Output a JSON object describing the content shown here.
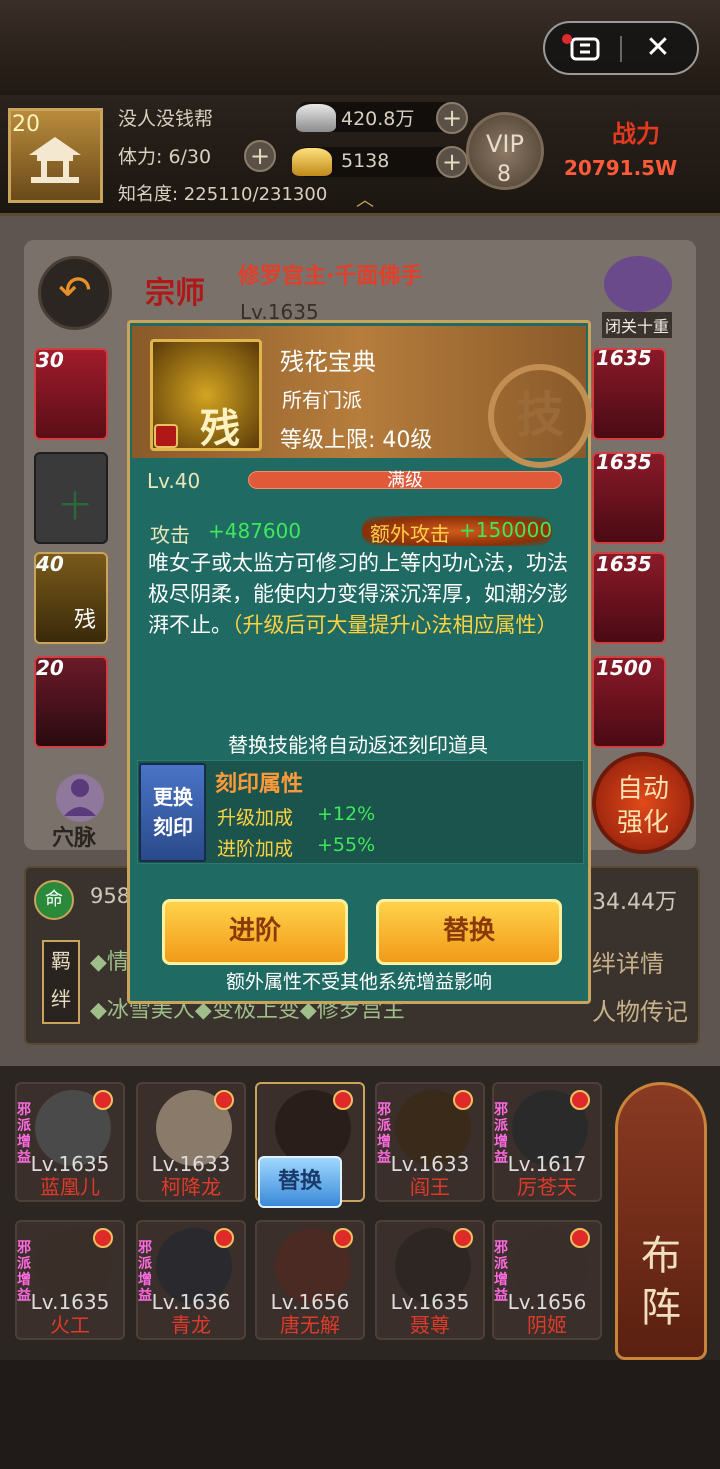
{
  "window": {
    "menu_icon": "menu-icon",
    "close_icon": "close-icon",
    "close_glyph": "✕"
  },
  "player": {
    "level": "20",
    "guild": "没人没钱帮",
    "stamina": "体力: 6/30",
    "fame": "知名度: 225110/231300",
    "silver": "420.8万",
    "gold": "5138",
    "vip_label": "VIP",
    "vip_level": "8",
    "power_label": "战力",
    "power_value": "20791.5W"
  },
  "background": {
    "hero_title": "修罗宫主·千面佛手",
    "hero_level": "Lv.1635",
    "seal": "宗师",
    "retreat_label": "闭关十重",
    "left_slots": [
      "30",
      "",
      "40",
      "20"
    ],
    "left_slot_chars": [
      "",
      "十",
      "残",
      ""
    ],
    "right_slots": [
      "1635",
      "1635",
      "1635",
      "1500"
    ],
    "acupoint_label": "穴脉",
    "auto_enhance": "自动强化",
    "life_icon": "命",
    "life_value": "958",
    "power_value": "34.44万",
    "bond_label": "羁绊",
    "bond_detail": "绊详情",
    "biography": "人物传记",
    "bond_row1": "◆情",
    "bond_row2": "◆冰雪美人◆变极上变◆修罗宫主"
  },
  "modal": {
    "skill_name": "残花宝典",
    "sect": "所有门派",
    "level_cap": "等级上限: 40级",
    "icon_char": "残",
    "emblem_char": "技",
    "level": "Lv.40",
    "level_status": "满级",
    "level_progress": 1.0,
    "attack_label": "攻击",
    "attack_value": "+487600",
    "extra_attack_label": "额外攻击",
    "extra_attack_value": "+150000",
    "description": "唯女子或太监方可修习的上等内功心法，功法极尽阴柔，能使内力变得深沉浑厚，如潮汐澎湃不止。",
    "description_hint": "（升级后可大量提升心法相应属性）",
    "notice": "替换技能将自动返还刻印道具",
    "engrave_icon": "更换刻印",
    "engrave_title": "刻印属性",
    "upgrade_bonus_label": "升级加成",
    "upgrade_bonus_value": "+12%",
    "advance_bonus_label": "进阶加成",
    "advance_bonus_value": "+55%",
    "advance_button": "进阶",
    "replace_button": "替换",
    "footer": "额外属性不受其他系统增益影响"
  },
  "heroes": {
    "row1": [
      {
        "tag": "邪派增益",
        "lv": "Lv.1635",
        "name": "蓝凰儿",
        "color": "#4a4a4a"
      },
      {
        "tag": "",
        "lv": "Lv.1633",
        "name": "柯降龙",
        "color": "#8a7a6a"
      },
      {
        "tag": "",
        "lv": "",
        "name": "",
        "color": "#2a1e1a"
      },
      {
        "tag": "邪派增益",
        "lv": "Lv.1633",
        "name": "阎王",
        "color": "#3a2a1a"
      },
      {
        "tag": "邪派增益",
        "lv": "Lv.1617",
        "name": "厉苍天",
        "color": "#2a2a2a"
      }
    ],
    "row2": [
      {
        "tag": "邪派增益",
        "lv": "Lv.1635",
        "name": "火工",
        "color": "#3a2f28"
      },
      {
        "tag": "邪派增益",
        "lv": "Lv.1636",
        "name": "青龙",
        "color": "#2a2a2e"
      },
      {
        "tag": "",
        "lv": "Lv.1656",
        "name": "唐无解",
        "color": "#4a2a22"
      },
      {
        "tag": "",
        "lv": "Lv.1635",
        "name": "聂尊",
        "color": "#2e2622"
      },
      {
        "tag": "邪派增益",
        "lv": "Lv.1656",
        "name": "阴姬",
        "color": "#3a2e2a"
      }
    ],
    "replace_badge": "替换",
    "formation": "布阵"
  },
  "colors": {
    "modal_bg": "#1f6a62",
    "accent_gold": "#c9a45a",
    "stat_green": "#3ee85a",
    "highlight_yellow": "#ffd240",
    "name_red": "#e03a2a"
  }
}
